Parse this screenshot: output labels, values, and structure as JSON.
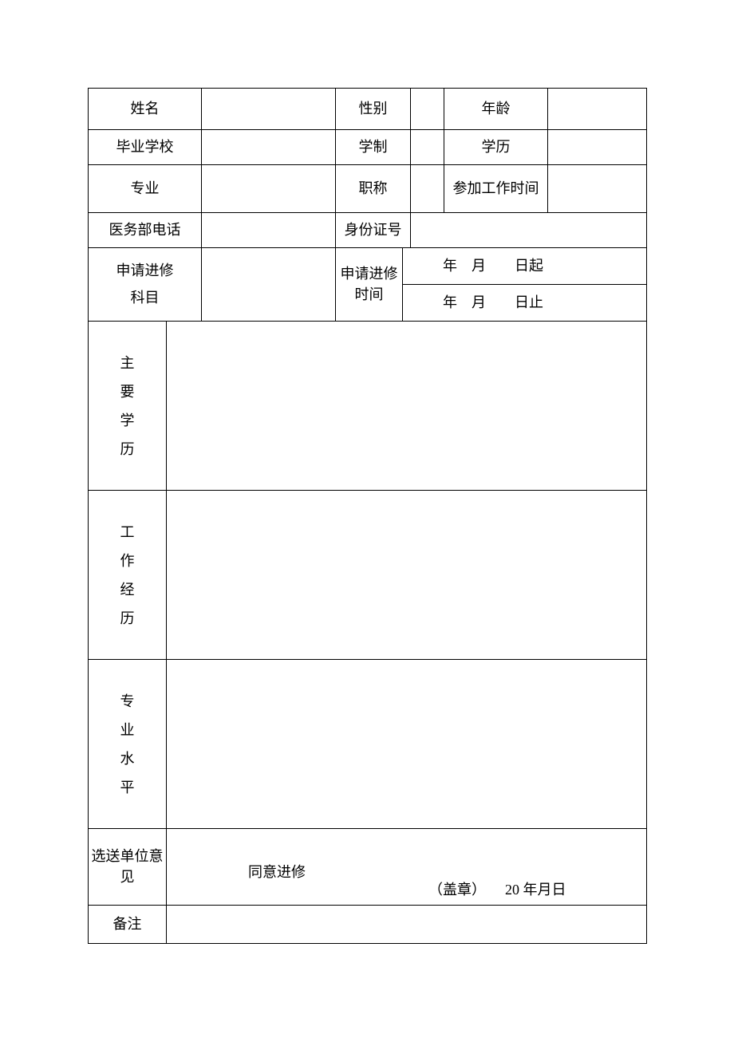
{
  "row1": {
    "name": "姓名",
    "gender": "性别",
    "age": "年龄"
  },
  "row2": {
    "school": "毕业学校",
    "system": "学制",
    "degree": "学历"
  },
  "row3": {
    "major": "专业",
    "title": "职称",
    "workTime": "参加工作时间"
  },
  "row4": {
    "phone": "医务部电话",
    "id": "身份证号"
  },
  "row5": {
    "subject1": "申请进修",
    "subject2": "科目",
    "time": "申请进修时间",
    "start": "年　月　　日起",
    "end": "年　月　　日止"
  },
  "section1": {
    "c1": "主",
    "c2": "要",
    "c3": "学",
    "c4": "历"
  },
  "section2": {
    "c1": "工",
    "c2": "作",
    "c3": "经",
    "c4": "历"
  },
  "section3": {
    "c1": "专",
    "c2": "业",
    "c3": "水",
    "c4": "平"
  },
  "opinion": {
    "label": "选送单位意见",
    "agree": "同意进修",
    "stamp": "（盖章）",
    "date": "20 年月日"
  },
  "remark": {
    "label": "备注"
  }
}
